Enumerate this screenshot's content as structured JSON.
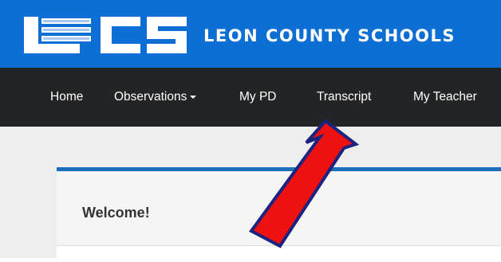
{
  "brand": {
    "name": "LEON COUNTY SCHOOLS",
    "logo_text": "LCS"
  },
  "nav": {
    "items": [
      {
        "label": "Home"
      },
      {
        "label": "Observations",
        "has_dropdown": true
      },
      {
        "label": "My PD"
      },
      {
        "label": "Transcript"
      },
      {
        "label": "My Teacher"
      }
    ]
  },
  "panel": {
    "title": "Welcome!"
  },
  "colors": {
    "header": "#0d6fd3",
    "nav": "#222426",
    "panel_accent": "#1c6fbd",
    "arrow_fill": "#ee1111",
    "arrow_stroke": "#1a237e"
  },
  "annotation": {
    "type": "arrow",
    "points_to": "Transcript"
  }
}
